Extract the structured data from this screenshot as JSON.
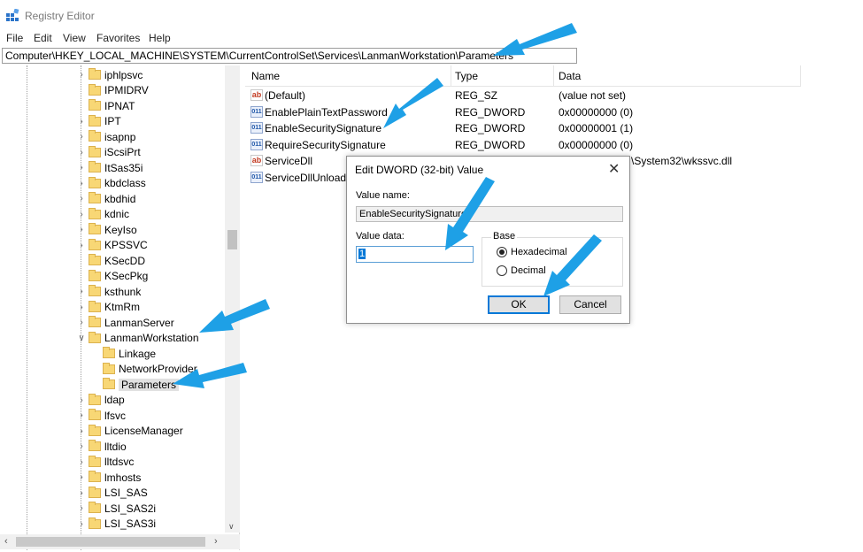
{
  "window": {
    "title": "Registry Editor"
  },
  "menu": [
    "File",
    "Edit",
    "View",
    "Favorites",
    "Help"
  ],
  "address": "Computer\\HKEY_LOCAL_MACHINE\\SYSTEM\\CurrentControlSet\\Services\\LanmanWorkstation\\Parameters",
  "tree": [
    {
      "label": "iphlpsvc",
      "expandable": true
    },
    {
      "label": "IPMIDRV",
      "expandable": false
    },
    {
      "label": "IPNAT",
      "expandable": false
    },
    {
      "label": "IPT",
      "expandable": true
    },
    {
      "label": "isapnp",
      "expandable": true
    },
    {
      "label": "iScsiPrt",
      "expandable": true
    },
    {
      "label": "ItSas35i",
      "expandable": true
    },
    {
      "label": "kbdclass",
      "expandable": true
    },
    {
      "label": "kbdhid",
      "expandable": true
    },
    {
      "label": "kdnic",
      "expandable": true
    },
    {
      "label": "KeyIso",
      "expandable": true
    },
    {
      "label": "KPSSVC",
      "expandable": true
    },
    {
      "label": "KSecDD",
      "expandable": false
    },
    {
      "label": "KSecPkg",
      "expandable": false
    },
    {
      "label": "ksthunk",
      "expandable": true
    },
    {
      "label": "KtmRm",
      "expandable": true
    },
    {
      "label": "LanmanServer",
      "expandable": true
    },
    {
      "label": "LanmanWorkstation",
      "expandable": true,
      "expanded": true
    },
    {
      "label": "Linkage",
      "child": true
    },
    {
      "label": "NetworkProvider",
      "child": true
    },
    {
      "label": "Parameters",
      "child": true,
      "selected": true
    },
    {
      "label": "ldap",
      "expandable": true
    },
    {
      "label": "lfsvc",
      "expandable": true
    },
    {
      "label": "LicenseManager",
      "expandable": true
    },
    {
      "label": "lltdio",
      "expandable": true
    },
    {
      "label": "lltdsvc",
      "expandable": true
    },
    {
      "label": "lmhosts",
      "expandable": true
    },
    {
      "label": "LSI_SAS",
      "expandable": true
    },
    {
      "label": "LSI_SAS2i",
      "expandable": true
    },
    {
      "label": "LSI_SAS3i",
      "expandable": true
    }
  ],
  "list": {
    "columns": [
      "Name",
      "Type",
      "Data"
    ],
    "rows": [
      {
        "icon": "string",
        "name": "(Default)",
        "type": "REG_SZ",
        "data": "(value not set)"
      },
      {
        "icon": "dword",
        "name": "EnablePlainTextPassword",
        "type": "REG_DWORD",
        "data": "0x00000000 (0)"
      },
      {
        "icon": "dword",
        "name": "EnableSecuritySignature",
        "type": "REG_DWORD",
        "data": "0x00000001 (1)"
      },
      {
        "icon": "dword",
        "name": "RequireSecuritySignature",
        "type": "REG_DWORD",
        "data": "0x00000000 (0)"
      },
      {
        "icon": "string",
        "name": "ServiceDll",
        "type": "",
        "data": "\\System32\\wkssvc.dll"
      },
      {
        "icon": "dword",
        "name": "ServiceDllUnloadO",
        "type": "",
        "data": ""
      }
    ]
  },
  "dialog": {
    "title": "Edit DWORD (32-bit) Value",
    "close": "✕",
    "value_name_label": "Value name:",
    "value_name": "EnableSecuritySignature",
    "value_data_label": "Value data:",
    "value_data": "1",
    "base_label": "Base",
    "hex_label": "Hexadecimal",
    "dec_label": "Decimal",
    "ok": "OK",
    "cancel": "Cancel"
  },
  "icons": {
    "app": "registry-editor-icon",
    "string_value": "ab",
    "dword_value": "011",
    "scroll_left": "‹",
    "scroll_right": "›",
    "scroll_down": "∨",
    "collapsed": "›",
    "expanded": "∨"
  },
  "colors": {
    "selection": "#0078d7",
    "annotation_arrow": "#1ea0e6",
    "folder": "#f8d775"
  }
}
